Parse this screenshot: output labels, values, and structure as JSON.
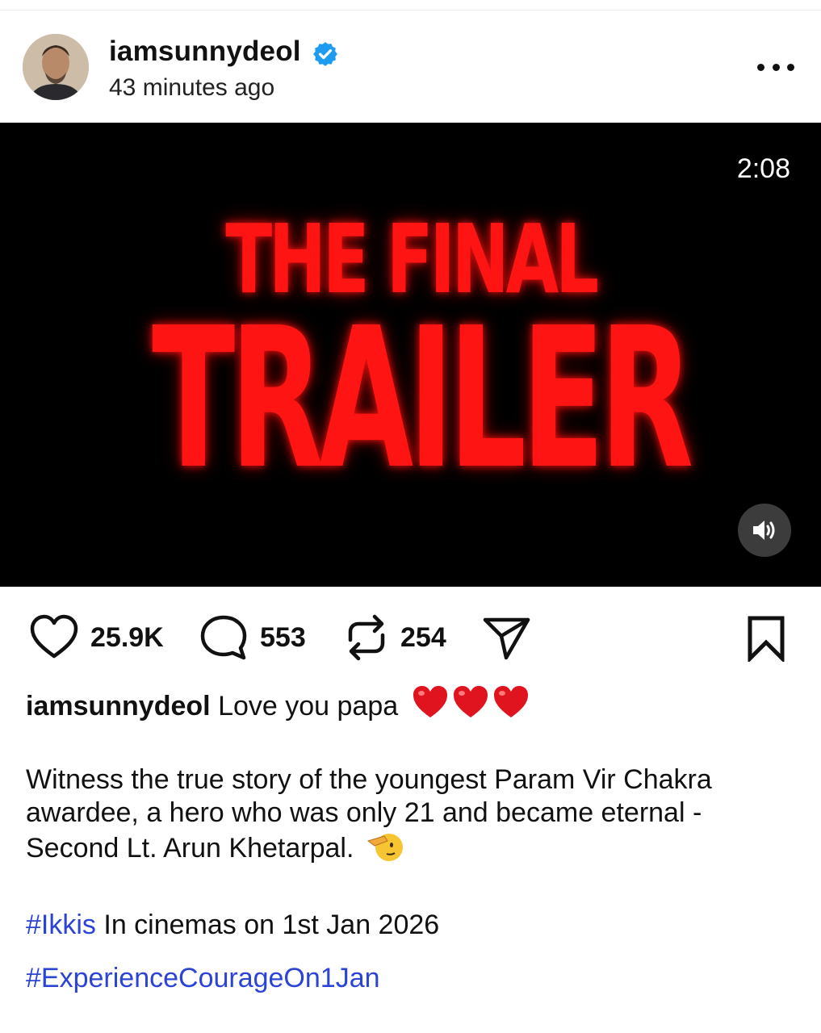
{
  "post": {
    "username": "iamsunnydeol",
    "timestamp": "43 minutes ago",
    "verified": true
  },
  "video": {
    "duration": "2:08",
    "title_line1": "THE FINAL",
    "title_line2": "TRAILER",
    "title_color": "#ff1414"
  },
  "actions": {
    "likes": "25.9K",
    "comments": "553",
    "reposts": "254"
  },
  "caption": {
    "username": "iamsunnydeol",
    "line1": "Love you papa",
    "paragraph2": "Witness the true story of the youngest Param Vir Chakra awardee, a hero who was only 21 and became eternal - Second Lt. Arun Khetarpal.",
    "hashtag1": "#Ikkis",
    "line3": "In cinemas on 1st Jan 2026",
    "hashtag2": "#ExperienceCourageOn1Jan"
  },
  "colors": {
    "hashtag": "#2b44d6",
    "verified_badge": "#1d9bf0",
    "heart_emoji": "#e0141e"
  },
  "icons": [
    "verified-icon",
    "more-icon",
    "mute-icon",
    "heart-icon",
    "comment-icon",
    "repost-icon",
    "share-icon",
    "bookmark-icon",
    "heart-emoji-icon",
    "salute-emoji-icon"
  ]
}
